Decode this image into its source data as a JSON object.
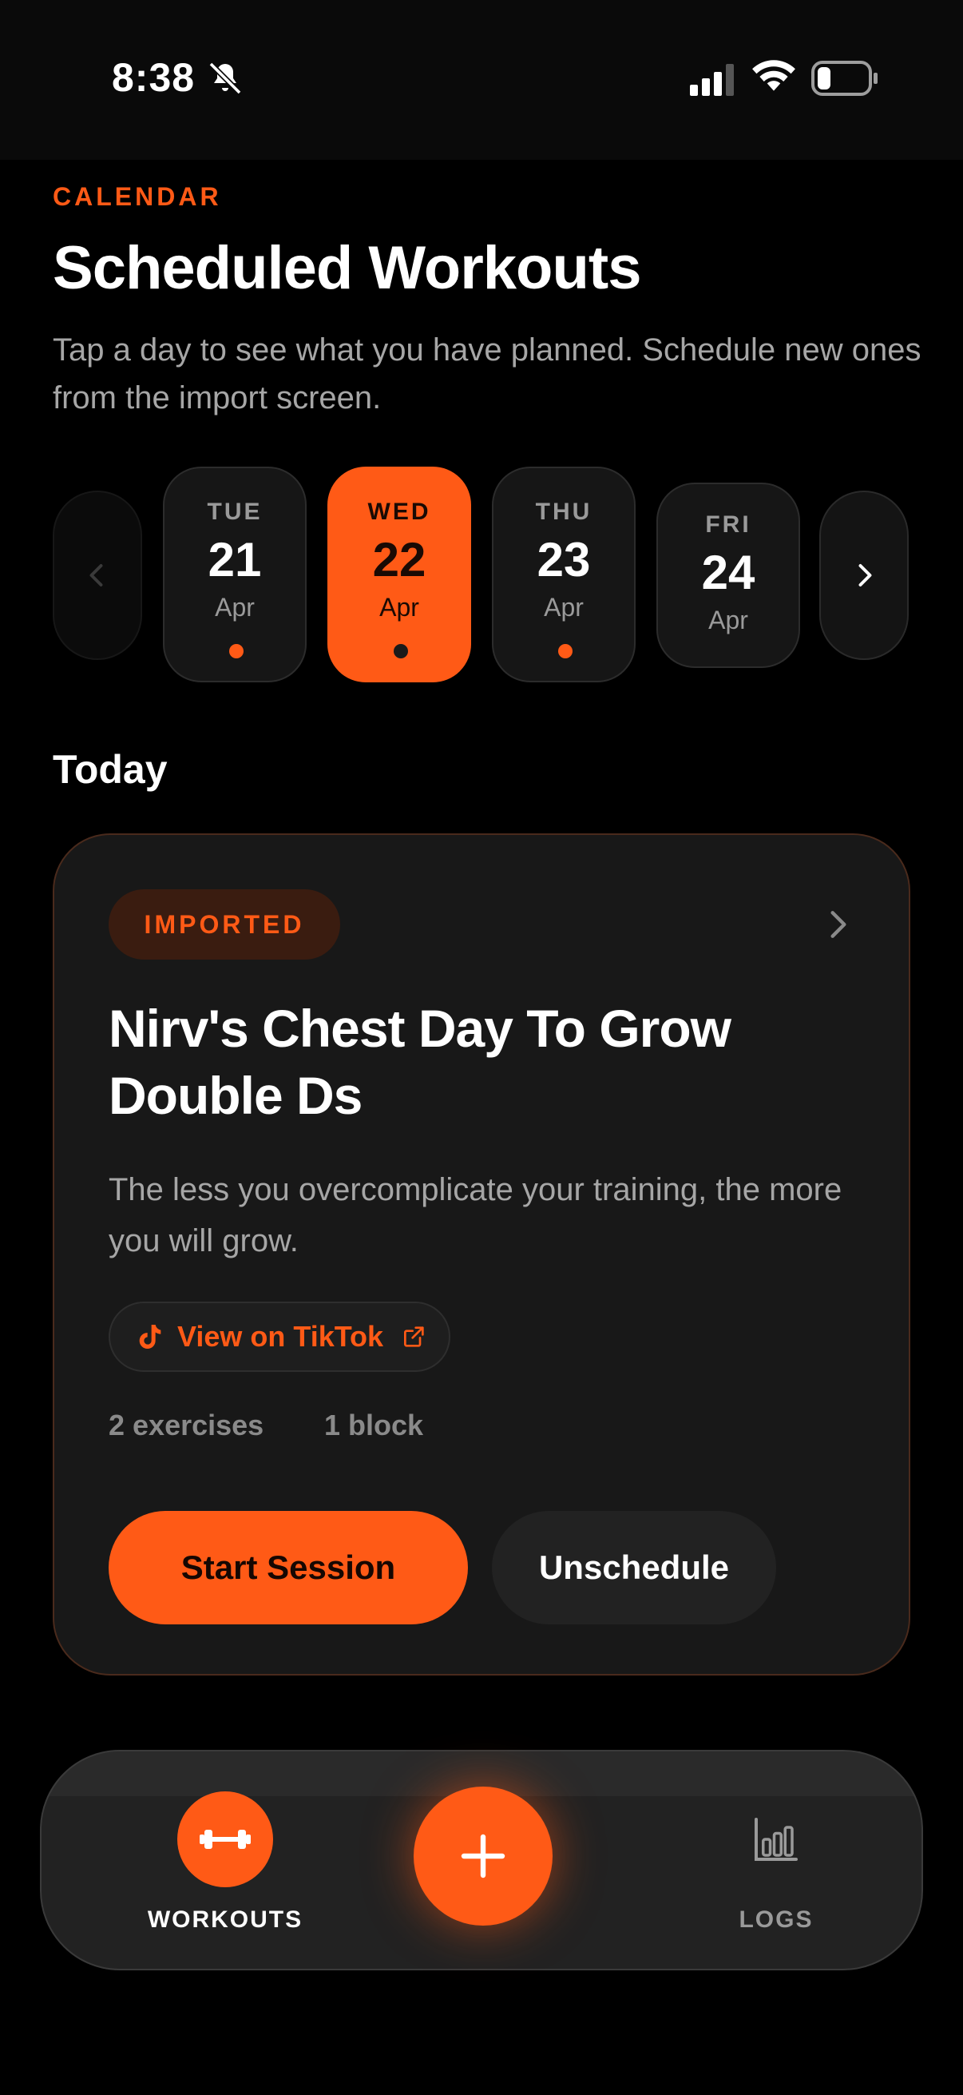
{
  "status_bar": {
    "time": "8:38",
    "icons": [
      "bell-slash-icon",
      "cellular-signal-icon",
      "wifi-icon",
      "battery-icon"
    ]
  },
  "header": {
    "eyebrow": "CALENDAR",
    "title": "Scheduled Workouts",
    "subtitle": "Tap a day to see what you have planned. Schedule new ones from the import screen."
  },
  "day_strip": {
    "prev_icon": "chevron-left-icon",
    "next_icon": "chevron-right-icon",
    "days": [
      {
        "dow": "TUE",
        "day": "21",
        "month": "Apr",
        "has_workout": true,
        "selected": false
      },
      {
        "dow": "WED",
        "day": "22",
        "month": "Apr",
        "has_workout": true,
        "selected": true
      },
      {
        "dow": "THU",
        "day": "23",
        "month": "Apr",
        "has_workout": true,
        "selected": false
      },
      {
        "dow": "FRI",
        "day": "24",
        "month": "Apr",
        "has_workout": false,
        "selected": false
      }
    ]
  },
  "today": {
    "section_title": "Today",
    "card": {
      "badge": "IMPORTED",
      "title": "Nirv's Chest Day To Grow Double Ds",
      "description": "The less you overcomplicate your training, the more you will grow.",
      "source_link": "View on TikTok",
      "exercise_count": "2 exercises",
      "block_count": "1 block",
      "start_label": "Start Session",
      "unschedule_label": "Unschedule"
    }
  },
  "tab_bar": {
    "workouts_label": "WORKOUTS",
    "logs_label": "LOGS",
    "add_icon": "plus-icon"
  },
  "colors": {
    "accent": "#ff5a16",
    "background": "#000000",
    "card": "#181818",
    "muted_text": "#a6a6a6"
  }
}
